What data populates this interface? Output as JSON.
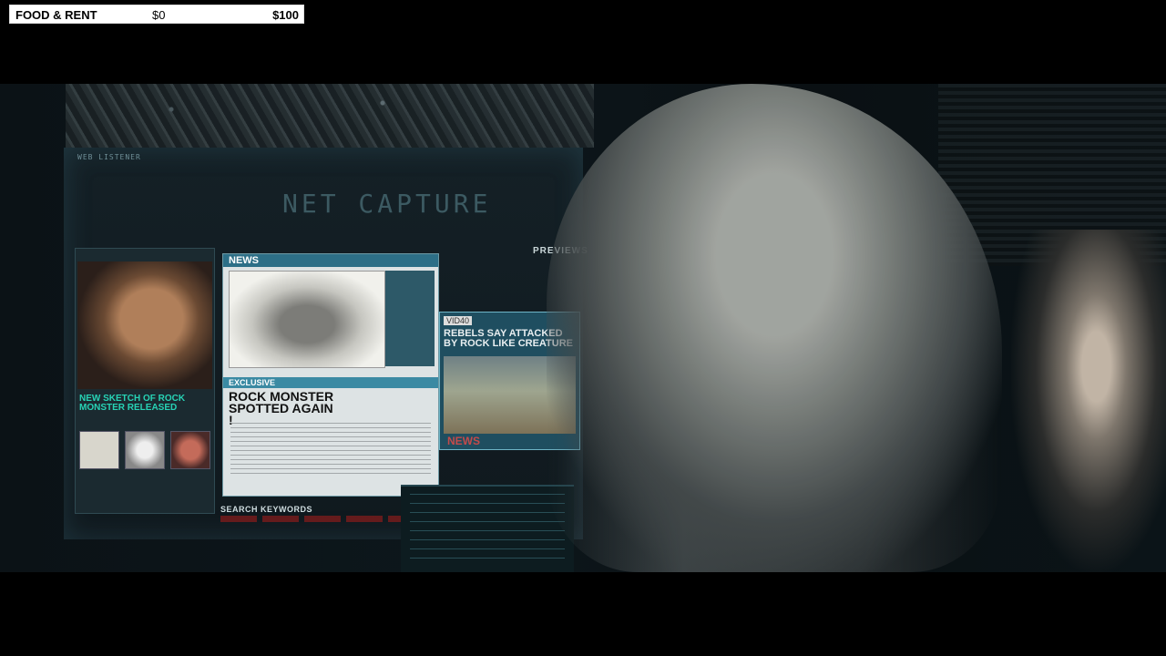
{
  "budget": {
    "label": "FOOD & RENT",
    "min": "$0",
    "max": "$100",
    "fill_fraction": 0
  },
  "scene": {
    "monitor": {
      "web_listener": "WEB LISTENER",
      "net_capture": "NET CAPTURE",
      "previews": "PREVIEWS",
      "left_caption": "NEW SKETCH OF ROCK MONSTER RELEASED",
      "news_title": "NEWS",
      "exclusive": "EXCLUSIVE",
      "headline": "ROCK MONSTER SPOTTED AGAIN !",
      "video_tag": "VID40",
      "video_headline": "REBELS SAY ATTACKED BY ROCK LIKE CREATURE",
      "video_news": "NEWS",
      "search_keywords": "SEARCH KEYWORDS"
    }
  }
}
